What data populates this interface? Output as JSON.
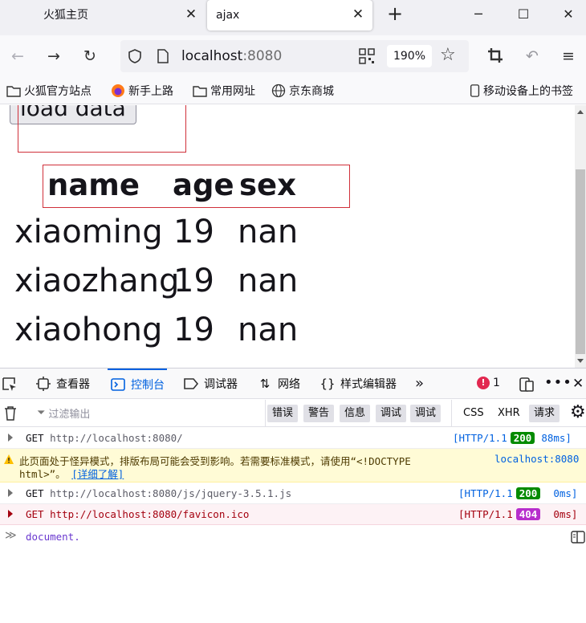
{
  "browser": {
    "tabs": [
      {
        "title": "火狐主页",
        "close": "✕"
      },
      {
        "title": "ajax",
        "close": "✕"
      }
    ],
    "new_tab": "+",
    "window_controls": [
      "─",
      "☐",
      "✕"
    ],
    "url_host": "localhost",
    "url_port": ":8080",
    "zoom": "190%",
    "bookmarks": [
      "火狐官方站点",
      "新手上路",
      "常用网址",
      "京东商城"
    ],
    "mobile_bookmarks": "移动设备上的书签"
  },
  "page": {
    "load_button": "load data",
    "headers": [
      "name",
      "age",
      "sex"
    ],
    "rows": [
      [
        "xiaoming",
        "19",
        "nan"
      ],
      [
        "xiaozhang",
        "19",
        "nan"
      ],
      [
        "xiaohong",
        "19",
        "nan"
      ]
    ]
  },
  "devtools": {
    "tabs": [
      "查看器",
      "控制台",
      "调试器",
      "网络",
      "样式编辑器"
    ],
    "error_count": "1",
    "filter_placeholder": "过滤输出",
    "levels": [
      "错误",
      "警告",
      "信息",
      "调试"
    ],
    "types": [
      "CSS",
      "XHR",
      "请求"
    ],
    "console": [
      {
        "method": "GET",
        "url": "http://localhost:8080/",
        "proto": "[HTTP/1.1",
        "status": "200",
        "time": "88ms]"
      },
      {
        "warning": "此页面处于怪异模式，排版布局可能会受到影响。若需要标准模式，请使用“<!DOCTYPE",
        "warning2": "html>”。",
        "link": "[详细了解]",
        "source": "localhost:8080"
      },
      {
        "method": "GET",
        "url": "http://localhost:8080/js/jquery-3.5.1.js",
        "proto": "[HTTP/1.1",
        "status": "200",
        "time": "0ms]"
      },
      {
        "method": "GET",
        "url": "http://localhost:8080/favicon.ico",
        "proto": "[HTTP/1.1",
        "status": "404",
        "time": "0ms]"
      }
    ],
    "input": "document.",
    "prompt": "≫"
  },
  "colors": {
    "accent": "#0061e0",
    "ok": "#058b00",
    "notfound": "#b72ecc",
    "error_bg": "#fdf2f5",
    "warn_bg": "#fffbd6",
    "red_outline": "#d0303a"
  }
}
